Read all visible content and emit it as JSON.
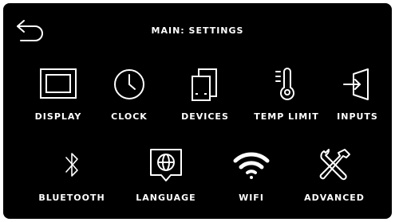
{
  "header": {
    "title": "MAIN: SETTINGS"
  },
  "tiles": {
    "display": {
      "label": "DISPLAY",
      "icon": "display-icon"
    },
    "clock": {
      "label": "CLOCK",
      "icon": "clock-icon"
    },
    "devices": {
      "label": "DEVICES",
      "icon": "devices-icon"
    },
    "temp_limit": {
      "label": "TEMP LIMIT",
      "icon": "thermometer-icon"
    },
    "inputs": {
      "label": "INPUTS",
      "icon": "inputs-icon"
    },
    "bluetooth": {
      "label": "BLUETOOTH",
      "icon": "bluetooth-icon"
    },
    "language": {
      "label": "LANGUAGE",
      "icon": "globe-icon"
    },
    "wifi": {
      "label": "WIFI",
      "icon": "wifi-icon"
    },
    "advanced": {
      "label": "ADVANCED",
      "icon": "tools-icon"
    }
  },
  "colors": {
    "background": "#000000",
    "foreground": "#ffffff"
  }
}
